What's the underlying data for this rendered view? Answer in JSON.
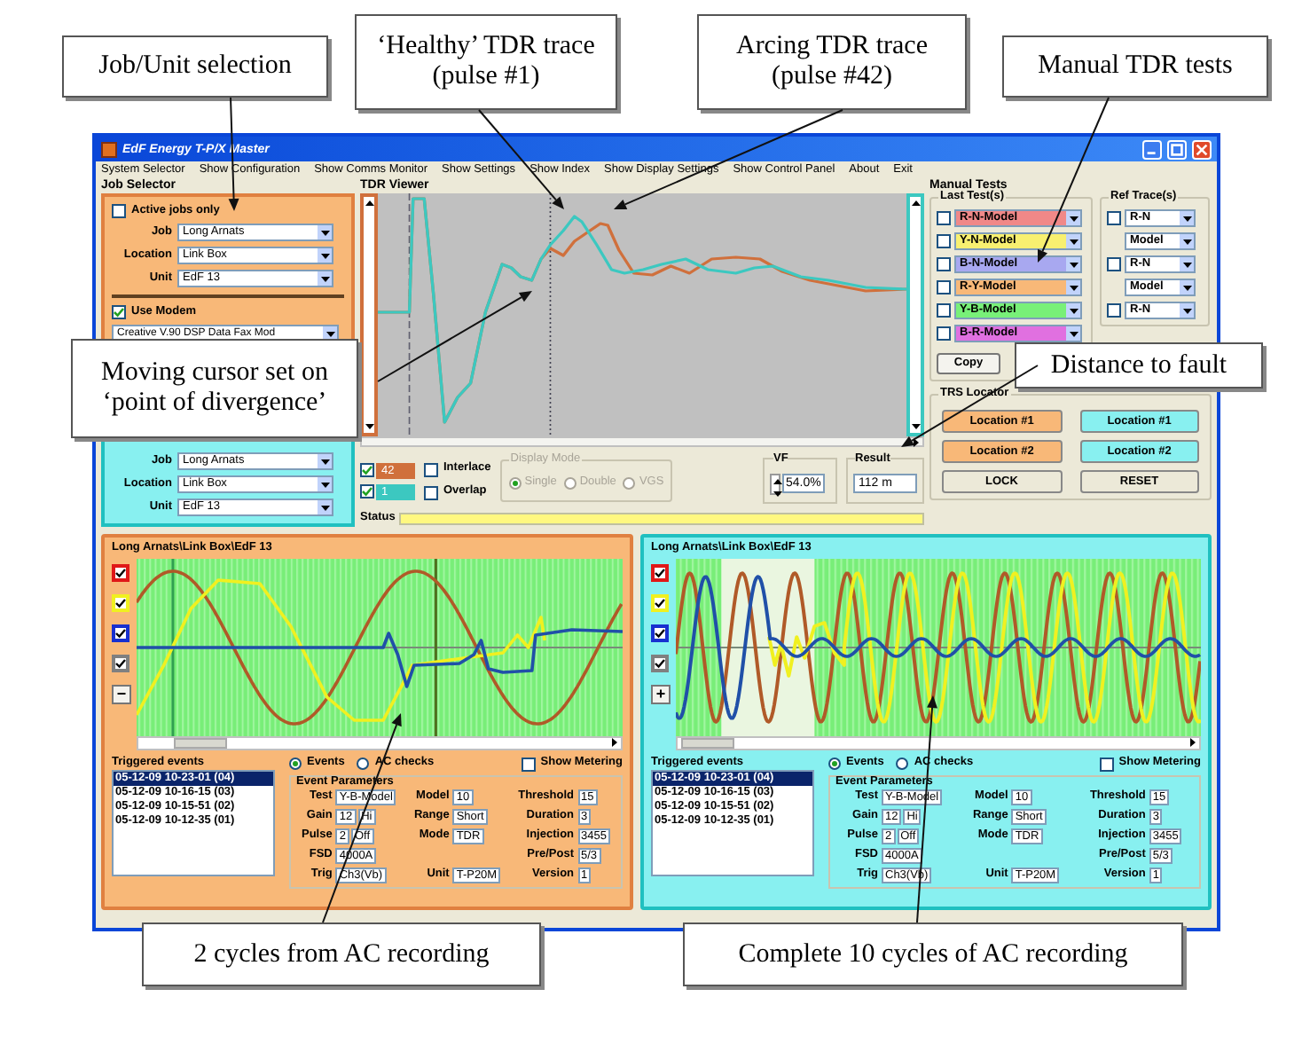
{
  "callouts": [
    {
      "text": "Job/Unit selection"
    },
    {
      "text": "‘Healthy’ TDR trace (pulse #1)"
    },
    {
      "text": "Arcing TDR trace (pulse #42)"
    },
    {
      "text": "Manual TDR tests"
    },
    {
      "text": "Moving cursor set on ‘point of divergence’"
    },
    {
      "text": "Distance to fault"
    },
    {
      "text": "2 cycles from AC recording"
    },
    {
      "text": "Complete 10 cycles of AC recording"
    }
  ],
  "window": {
    "title": "EdF Energy T-P/X Master"
  },
  "menu": [
    "System Selector",
    "Show Configuration",
    "Show Comms Monitor",
    "Show Settings",
    "Show Index",
    "Show Display Settings",
    "Show Control Panel",
    "About",
    "Exit"
  ],
  "job_selector": {
    "title": "Job Selector",
    "active_jobs_only": {
      "label": "Active jobs only",
      "checked": false
    },
    "fields": [
      {
        "label": "Job",
        "value": "Long Arnats"
      },
      {
        "label": "Location",
        "value": "Link Box"
      },
      {
        "label": "Unit",
        "value": "EdF 13"
      }
    ],
    "use_modem": {
      "label": "Use Modem",
      "checked": true
    },
    "modem": "Creative V.90 DSP Data Fax Mod",
    "fields_2": [
      {
        "label": "Job",
        "value": "Long Arnats"
      },
      {
        "label": "Location",
        "value": "Link Box"
      },
      {
        "label": "Unit",
        "value": "EdF 13"
      }
    ]
  },
  "tdr_viewer": {
    "title": "TDR Viewer",
    "traces": [
      {
        "label": "42",
        "checked": true,
        "color": "#d0703c"
      },
      {
        "label": "1",
        "checked": true,
        "color": "#3cc8c0"
      }
    ],
    "interlace": {
      "label": "Interlace",
      "checked": false
    },
    "overlap": {
      "label": "Overlap",
      "checked": false
    },
    "display_mode": {
      "title": "Display Mode",
      "disabled": true,
      "options": [
        {
          "label": "Single",
          "selected": true
        },
        {
          "label": "Double",
          "selected": false
        },
        {
          "label": "VGS",
          "selected": false
        }
      ]
    },
    "vf": {
      "label": "VF",
      "value": "54.0%"
    },
    "result": {
      "label": "Result",
      "value": "112 m"
    },
    "status_label": "Status"
  },
  "manual_tests": {
    "title": "Manual Tests",
    "last_tests_title": "Last Test(s)",
    "last_tests": [
      {
        "value": "R-N-Model",
        "color": "#f08888",
        "checked": false
      },
      {
        "value": "Y-N-Model",
        "color": "#f8f070",
        "checked": false
      },
      {
        "value": "B-N-Model",
        "color": "#a8a8f0",
        "checked": false
      },
      {
        "value": "R-Y-Model",
        "color": "#f8b878",
        "checked": false
      },
      {
        "value": "Y-B-Model",
        "color": "#78f078",
        "checked": false
      },
      {
        "value": "B-R-Model",
        "color": "#e070e0",
        "checked": false
      }
    ],
    "ref_title": "Ref Trace(s)",
    "ref_traces": [
      {
        "kind": "check",
        "value": "R-N",
        "checked": false
      },
      {
        "kind": "plain",
        "value": "Model"
      },
      {
        "kind": "check",
        "value": "R-N",
        "checked": false
      },
      {
        "kind": "plain",
        "value": "Model"
      },
      {
        "kind": "check",
        "value": "R-N",
        "checked": false
      }
    ],
    "copy_button": "Copy"
  },
  "trs_locator": {
    "title": "TRS Locator",
    "buttons": [
      {
        "label": "Location #1",
        "color": "#f8b878"
      },
      {
        "label": "Location #1",
        "color": "#88f0f0"
      },
      {
        "label": "Location #2",
        "color": "#f8b878"
      },
      {
        "label": "Location #2",
        "color": "#88f0f0"
      },
      {
        "label": "LOCK",
        "color": "#ece9d8"
      },
      {
        "label": "RESET",
        "color": "#ece9d8"
      }
    ]
  },
  "bottom_panels": [
    {
      "path": "Long Arnats\\Link Box\\EdF 13",
      "color": "#f8b878",
      "kind": "short",
      "zoom_button": "−",
      "channels": [
        {
          "color": "#e01818",
          "checked": true
        },
        {
          "color": "#f0f020",
          "checked": true
        },
        {
          "color": "#1830d0",
          "checked": true
        },
        {
          "color": "#808080",
          "checked": true
        }
      ],
      "triggered_title": "Triggered events",
      "events": [
        {
          "text": "05-12-09 10-23-01 (04)",
          "selected": true
        },
        {
          "text": "05-12-09 10-16-15 (03)",
          "selected": false
        },
        {
          "text": "05-12-09 10-15-51 (02)",
          "selected": false
        },
        {
          "text": "05-12-09 10-12-35 (01)",
          "selected": false
        }
      ],
      "radios": [
        {
          "label": "Events",
          "selected": true
        },
        {
          "label": "AC checks",
          "selected": false
        }
      ],
      "show_metering": {
        "label": "Show Metering",
        "checked": false
      },
      "params_title": "Event Parameters",
      "params": {
        "column_1": [
          {
            "label": "Test",
            "values": [
              "Y-B-Model"
            ]
          },
          {
            "label": "Gain",
            "values": [
              "12",
              "Hi"
            ]
          },
          {
            "label": "Pulse",
            "values": [
              "2",
              "Off"
            ]
          },
          {
            "label": "FSD",
            "values": [
              "4000A"
            ]
          },
          {
            "label": "Trig",
            "values": [
              "Ch3(Vb)"
            ]
          }
        ],
        "column_2": [
          {
            "label": "Model",
            "values": [
              "10"
            ]
          },
          {
            "label": "Range",
            "values": [
              "Short"
            ]
          },
          {
            "label": "Mode",
            "values": [
              "TDR"
            ]
          },
          {
            "label": "Unit",
            "values": [
              "T-P20M"
            ]
          }
        ],
        "column_3": [
          {
            "label": "Threshold",
            "values": [
              "15"
            ]
          },
          {
            "label": "Duration",
            "values": [
              "3"
            ]
          },
          {
            "label": "Injection",
            "values": [
              "3455"
            ]
          },
          {
            "label": "Pre/Post",
            "values": [
              "5/3"
            ]
          },
          {
            "label": "Version",
            "values": [
              "1"
            ]
          }
        ]
      }
    },
    {
      "path": "Long Arnats\\Link Box\\EdF 13",
      "color": "#88f0f0",
      "kind": "long",
      "zoom_button": "+",
      "channels": [
        {
          "color": "#e01818",
          "checked": true
        },
        {
          "color": "#f0f020",
          "checked": true
        },
        {
          "color": "#1830d0",
          "checked": true
        },
        {
          "color": "#808080",
          "checked": true
        }
      ],
      "triggered_title": "Triggered events",
      "events": [
        {
          "text": "05-12-09 10-23-01 (04)",
          "selected": true
        },
        {
          "text": "05-12-09 10-16-15 (03)",
          "selected": false
        },
        {
          "text": "05-12-09 10-15-51 (02)",
          "selected": false
        },
        {
          "text": "05-12-09 10-12-35 (01)",
          "selected": false
        }
      ],
      "radios": [
        {
          "label": "Events",
          "selected": true
        },
        {
          "label": "AC checks",
          "selected": false
        }
      ],
      "show_metering": {
        "label": "Show Metering",
        "checked": false
      },
      "params_title": "Event Parameters",
      "params": {
        "column_1": [
          {
            "label": "Test",
            "values": [
              "Y-B-Model"
            ]
          },
          {
            "label": "Gain",
            "values": [
              "12",
              "Hi"
            ]
          },
          {
            "label": "Pulse",
            "values": [
              "2",
              "Off"
            ]
          },
          {
            "label": "FSD",
            "values": [
              "4000A"
            ]
          },
          {
            "label": "Trig",
            "values": [
              "Ch3(Vb)"
            ]
          }
        ],
        "column_2": [
          {
            "label": "Model",
            "values": [
              "10"
            ]
          },
          {
            "label": "Range",
            "values": [
              "Short"
            ]
          },
          {
            "label": "Mode",
            "values": [
              "TDR"
            ]
          },
          {
            "label": "Unit",
            "values": [
              "T-P20M"
            ]
          }
        ],
        "column_3": [
          {
            "label": "Threshold",
            "values": [
              "15"
            ]
          },
          {
            "label": "Duration",
            "values": [
              "3"
            ]
          },
          {
            "label": "Injection",
            "values": [
              "3455"
            ]
          },
          {
            "label": "Pre/Post",
            "values": [
              "5/3"
            ]
          },
          {
            "label": "Version",
            "values": [
              "1"
            ]
          }
        ]
      }
    }
  ]
}
